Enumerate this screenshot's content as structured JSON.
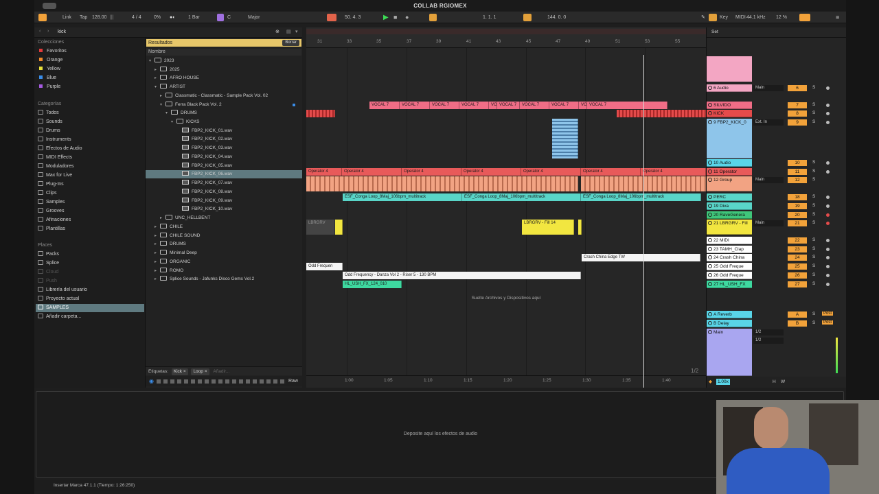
{
  "window": {
    "title": "COLLAB RGIOMEX"
  },
  "control_bar": {
    "link": "Link",
    "tap": "Tap",
    "tempo": "128.00",
    "signature": "4 / 4",
    "cpu_like": "0%",
    "quantize": "1 Bar",
    "key": "C",
    "scale": "Major",
    "position": "50.  4.  3",
    "loop_start": "1.  1.  1",
    "loop_length": "144.  0.  0",
    "key_label": "Key",
    "midi_label": "MIDI",
    "sample_rate": "44.1 kHz",
    "cpu": "12 %"
  },
  "browser": {
    "search_value": "kick",
    "collections_header": "Colecciones",
    "collections": [
      {
        "label": "Favoritos",
        "color": "#e23b3b"
      },
      {
        "label": "Orange",
        "color": "#f08a2c"
      },
      {
        "label": "Yellow",
        "color": "#e8e03a"
      },
      {
        "label": "Blue",
        "color": "#3a8de8"
      },
      {
        "label": "Purple",
        "color": "#a55ae0"
      }
    ],
    "categories_header": "Categorías",
    "categories": [
      "Todos",
      "Sounds",
      "Drums",
      "Instruments",
      "Efectos de Audio",
      "MIDI Effects",
      "Moduladores",
      "Max for Live",
      "Plug-Ins",
      "Clips",
      "Samples",
      "Grooves",
      "Afinaciones",
      "Plantillas"
    ],
    "places_header": "Places",
    "places": [
      "Packs",
      "Splice",
      "Cloud",
      "Push",
      "Librería del usuario",
      "Proyecto actual",
      "SAMPLES",
      "Añadir carpeta..."
    ],
    "results_header": "Resultados",
    "clear_button": "Borrar",
    "name_column": "Nombre",
    "tree": [
      "2023",
      "2025",
      "AFRO HOUSE",
      "ARTIST",
      "Classmatic - Classmatic - Sample Pack Vol. 02",
      "Ferra Black Pack Vol. 2",
      "DRUMS",
      "KICKS",
      "FBP2_KICK_01.wav",
      "FBP2_KICK_02.wav",
      "FBP2_KICK_03.wav",
      "FBP2_KICK_04.wav",
      "FBP2_KICK_05.wav",
      "FBP2_KICK_06.wav",
      "FBP2_KICK_07.wav",
      "FBP2_KICK_08.wav",
      "FBP2_KICK_09.wav",
      "FBP2_KICK_10.wav",
      "UNC_HELLBENT",
      "CHILE",
      "CHILE SOUND",
      "DRUMS",
      "Minimal Deep",
      "ORGANIC",
      "ROMO",
      "Splice Sounds - Jafunks Disco Gems Vol.2"
    ],
    "labels_title": "Etiquetas:",
    "tags": [
      "Kick",
      "Loop"
    ],
    "add_tag_placeholder": "Añadir...",
    "raw_label": "Raw"
  },
  "arrangement": {
    "bar_numbers": [
      "31",
      "33",
      "35",
      "37",
      "39",
      "41",
      "43",
      "45",
      "47",
      "49",
      "51",
      "53",
      "55"
    ],
    "time_labels": [
      "1:00",
      "1:05",
      "1:10",
      "1:15",
      "1:20",
      "1:25",
      "1:30",
      "1:35",
      "1:40"
    ],
    "vocal_clip": "VOCAL 7",
    "vocal_clip_short": "VO",
    "operator_clip": "Operator 4",
    "conga_clip": "ESF_Conga Loop_8Maj_106bpm_multitrack",
    "conga_clip_partial": "ESF_Conga Loop_8Maj_106bpm_multitrack",
    "lbrgrv_clip": "LBRGRV",
    "fill_clip": "LBRGRV - Fill 14",
    "crash_clip": "Crash China Edge TW",
    "odd_clip": "Odd Frequen",
    "riser_clip": "Odd Frequency - Danza Vol 2 - Riser 5 - 130 BPM",
    "fx_clip": "HL_USH_FX_124_010",
    "drop_hint": "Suelte Archivos y Dispositivos aquí",
    "page_indicator": "1/2"
  },
  "mixer": {
    "set_label": "Set",
    "tracks": [
      {
        "name": "6 Audio",
        "num": "6",
        "color": "#f3a6c3",
        "route": "Main"
      },
      {
        "name": "SILVIDO",
        "num": "7",
        "color": "#f06d86",
        "route": ""
      },
      {
        "name": "KICK",
        "num": "8",
        "color": "#e44b4b",
        "route": ""
      },
      {
        "name": "9 FBP2_KICK_0",
        "num": "9",
        "color": "#8ec5ea",
        "route": "Ext. In"
      },
      {
        "name": "10 Audio",
        "num": "10",
        "color": "#59d5e8",
        "route": ""
      },
      {
        "name": "11 Operator",
        "num": "11",
        "color": "#e85a5a",
        "route": ""
      },
      {
        "name": "12 Group",
        "num": "12",
        "color": "#f2a383",
        "route": "Main"
      },
      {
        "name": "PERC",
        "num": "18",
        "color": "#59d5c8",
        "route": ""
      },
      {
        "name": "19 Diva",
        "num": "19",
        "color": "#59d5c8",
        "route": ""
      },
      {
        "name": "20 RaveGenera",
        "num": "20",
        "color": "#3fc67a",
        "route": ""
      },
      {
        "name": "21 LBRGRV - Fill",
        "num": "21",
        "color": "#f2e640",
        "route": "Main"
      },
      {
        "name": "22 MIDI",
        "num": "22",
        "color": "#ffffff",
        "route": ""
      },
      {
        "name": "23 TAMH_Clap",
        "num": "23",
        "color": "#ffffff",
        "route": ""
      },
      {
        "name": "24 Crash China",
        "num": "24",
        "color": "#ffffff",
        "route": ""
      },
      {
        "name": "25 Odd Freque",
        "num": "25",
        "color": "#ffffff",
        "route": ""
      },
      {
        "name": "26 Odd Freque",
        "num": "26",
        "color": "#ffffff",
        "route": ""
      },
      {
        "name": "27 HL_USH_FX",
        "num": "27",
        "color": "#3ed9a0",
        "route": ""
      }
    ],
    "returns": [
      {
        "name": "A Reverb",
        "num": "A",
        "color": "#59d5e8",
        "post": "Post"
      },
      {
        "name": "B Delay",
        "num": "B",
        "color": "#59d5e8",
        "post": "Post"
      }
    ],
    "main": {
      "name": "Main",
      "route1": "1/2",
      "route2": "1/2"
    },
    "zoom": "1.00x",
    "hw_labels": [
      "H",
      "W"
    ]
  },
  "detail": {
    "drop_hint": "Deposite aquí los efectos de audio"
  },
  "status": {
    "message": "Insertar Marca 47.1.1 (Tiempo: 1:26:250)"
  }
}
